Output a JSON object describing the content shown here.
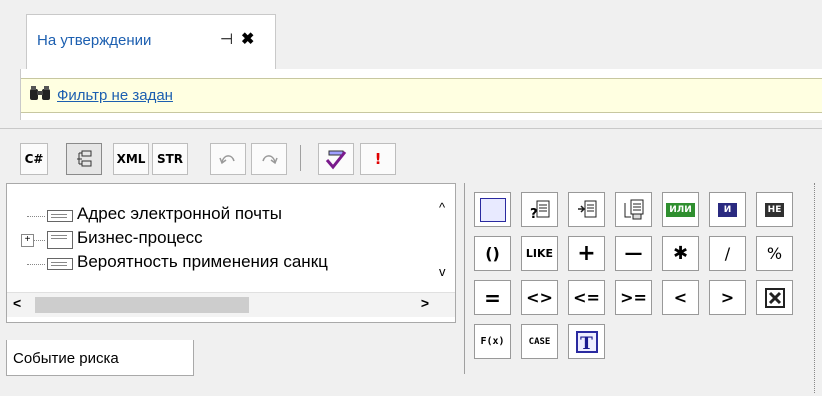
{
  "doc_tab": {
    "label": "На утверждении",
    "pin": "⊣⊦",
    "close": "✖"
  },
  "filter": {
    "link": "Фильтр не задан"
  },
  "toolbar": {
    "csharp": "C#",
    "xml": "XML",
    "str": "STR",
    "bang": "!"
  },
  "tree": {
    "items": [
      {
        "label": "Адрес электронной почты",
        "expandable": false
      },
      {
        "label": "Бизнес-процесс",
        "expandable": true
      },
      {
        "label": "Вероятность применения санкц",
        "expandable": false
      }
    ],
    "expand_glyph": "+",
    "up": "^",
    "down": "v",
    "left": "<",
    "right": ">"
  },
  "bottom_tab": {
    "label": "Событие риска"
  },
  "palette": {
    "or": "ИЛИ",
    "and": "И",
    "not": "НЕ",
    "parens": "()",
    "like": "LIKE",
    "plus": "+",
    "minus": "—",
    "mul": "✱",
    "div": "/",
    "mod": "%",
    "eq": "=",
    "neq": "<>",
    "le": "<=",
    "ge": ">=",
    "lt": "<",
    "gt": ">",
    "func": "F(x)",
    "case": "CASE",
    "text": "T"
  }
}
